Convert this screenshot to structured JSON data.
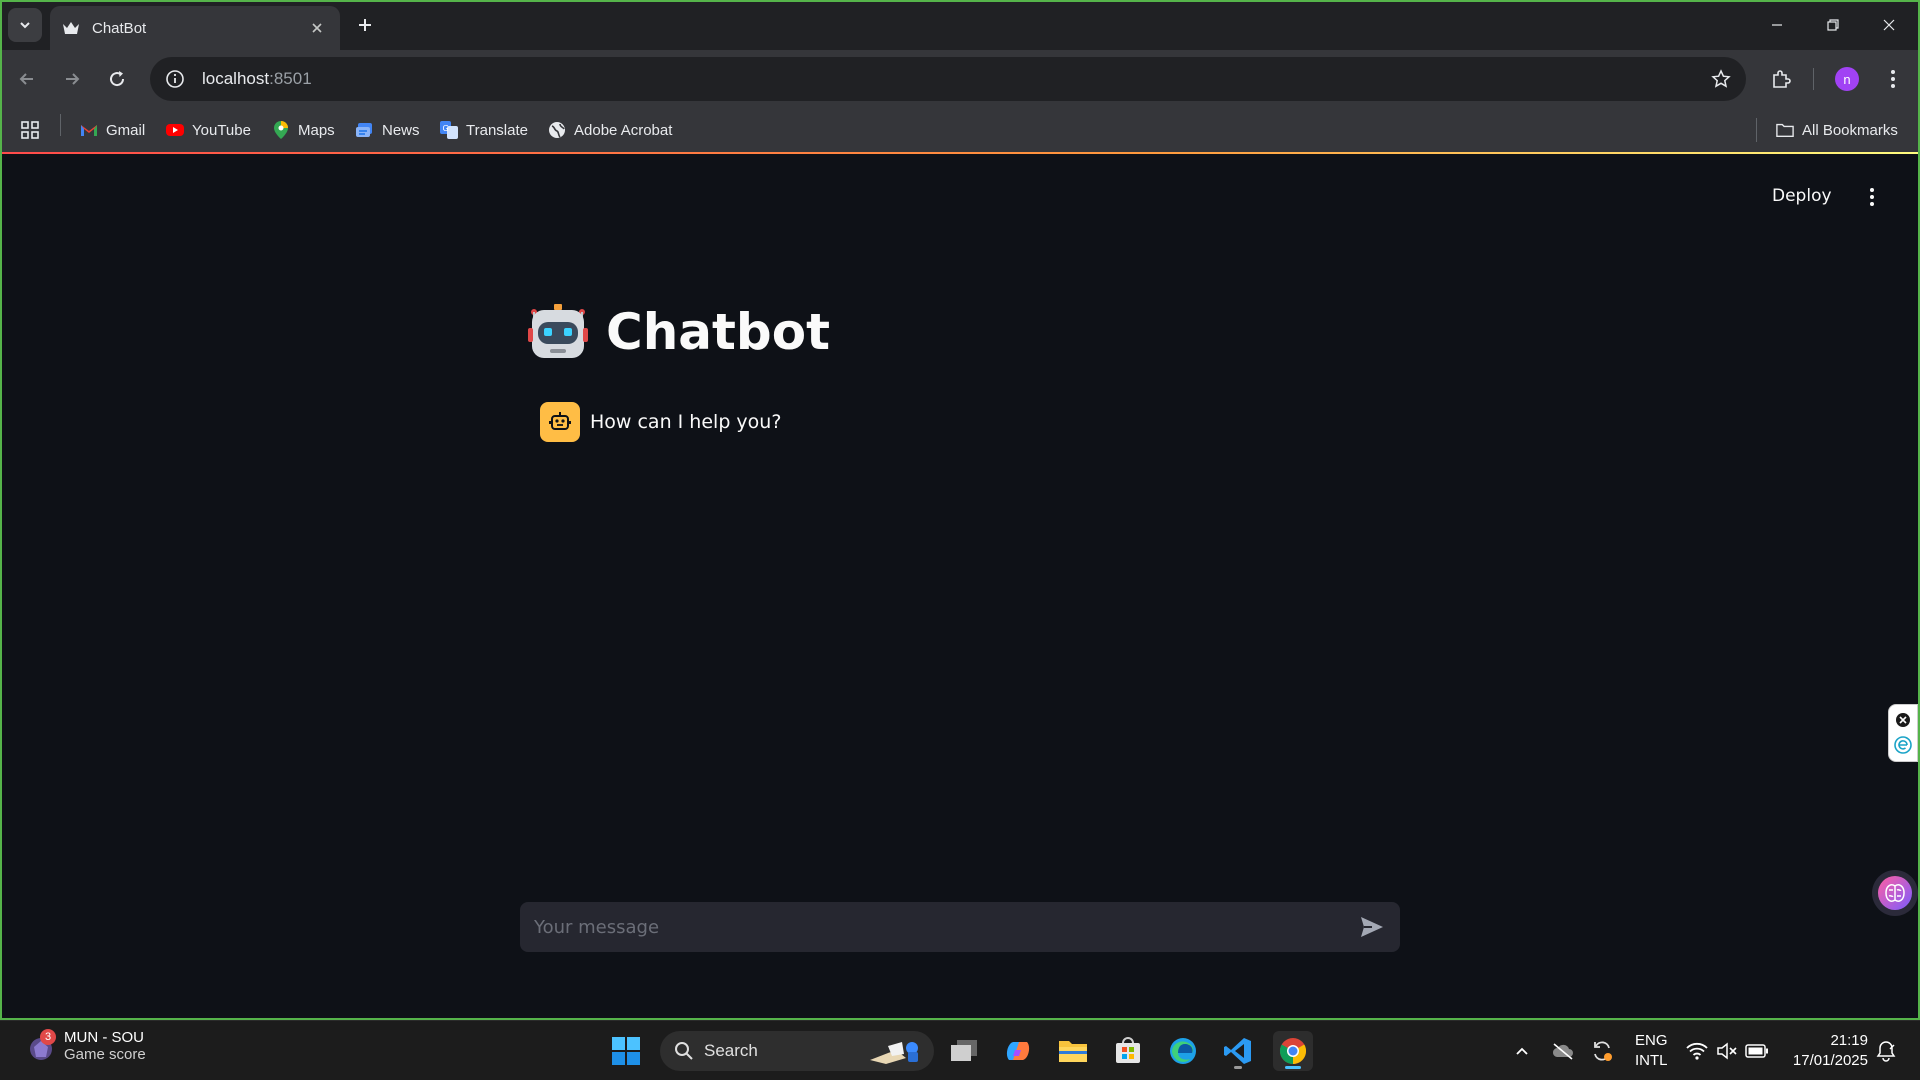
{
  "browser": {
    "tab_title": "ChatBot",
    "url_host": "localhost",
    "url_port": ":8501",
    "profile_initial": "n",
    "bookmarks": [
      "Gmail",
      "YouTube",
      "Maps",
      "News",
      "Translate",
      "Adobe Acrobat"
    ],
    "all_bookmarks": "All Bookmarks"
  },
  "app": {
    "deploy_label": "Deploy",
    "title": "Chatbot",
    "messages": [
      {
        "role": "assistant",
        "text": "How can I help you?"
      }
    ],
    "input_placeholder": "Your message",
    "accent_color": "#ffbd45",
    "background_color": "#0e1117"
  },
  "taskbar": {
    "widget_badge": "3",
    "widget_title": "MUN - SOU",
    "widget_subtitle": "Game score",
    "search_label": "Search",
    "lang_line1": "ENG",
    "lang_line2": "INTL",
    "time": "21:19",
    "date": "17/01/2025"
  }
}
